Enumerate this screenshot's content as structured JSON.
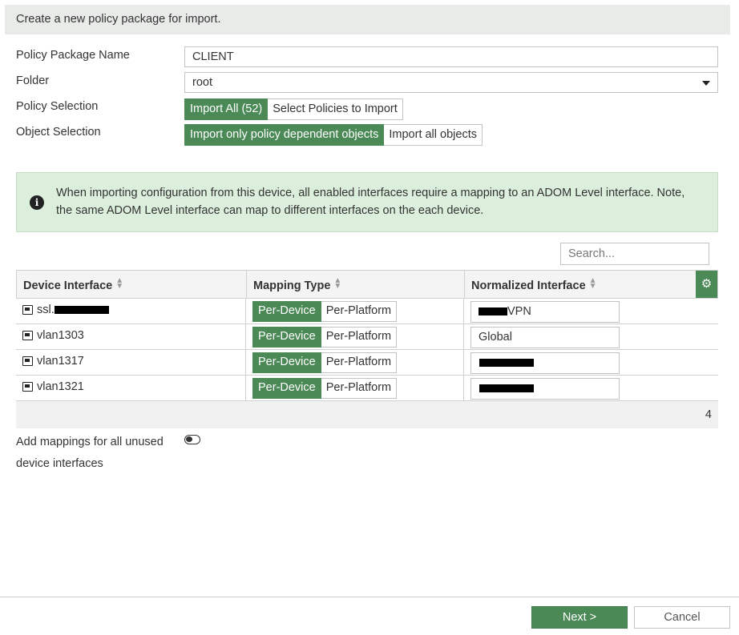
{
  "header": {
    "title": "Create a new policy package for import."
  },
  "form": {
    "package_name_label": "Policy Package Name",
    "package_name_value": "CLIENT",
    "folder_label": "Folder",
    "folder_value": "root",
    "policy_selection_label": "Policy Selection",
    "policy_options": [
      "Import All (52)",
      "Select Policies to Import"
    ],
    "object_selection_label": "Object Selection",
    "object_options": [
      "Import only policy dependent objects",
      "Import all objects"
    ]
  },
  "info": {
    "icon": "info-icon",
    "line1": "When importing configuration from this device, all enabled interfaces require a mapping to an ADOM Level interface. Note,",
    "line2": "the same ADOM Level interface can map to different interfaces on the each device."
  },
  "search": {
    "placeholder": "Search..."
  },
  "table": {
    "columns": [
      "Device Interface",
      "Mapping Type",
      "Normalized Interface"
    ],
    "mapping_options": [
      "Per-Device",
      "Per-Platform"
    ],
    "rows": [
      {
        "device": "ssl.",
        "normalized": "VPN"
      },
      {
        "device": "vlan1303",
        "normalized": "Global"
      },
      {
        "device": "vlan1317",
        "normalized": ""
      },
      {
        "device": "vlan1321",
        "normalized": ""
      }
    ],
    "count": "4"
  },
  "unused": {
    "label_line1": "Add mappings for all unused",
    "label_line2": "device interfaces"
  },
  "buttons": {
    "next": "Next >",
    "cancel": "Cancel"
  },
  "colors": {
    "accent": "#4b8a57",
    "info_bg": "#dcefdc",
    "header_bg": "#e9ebe9"
  }
}
